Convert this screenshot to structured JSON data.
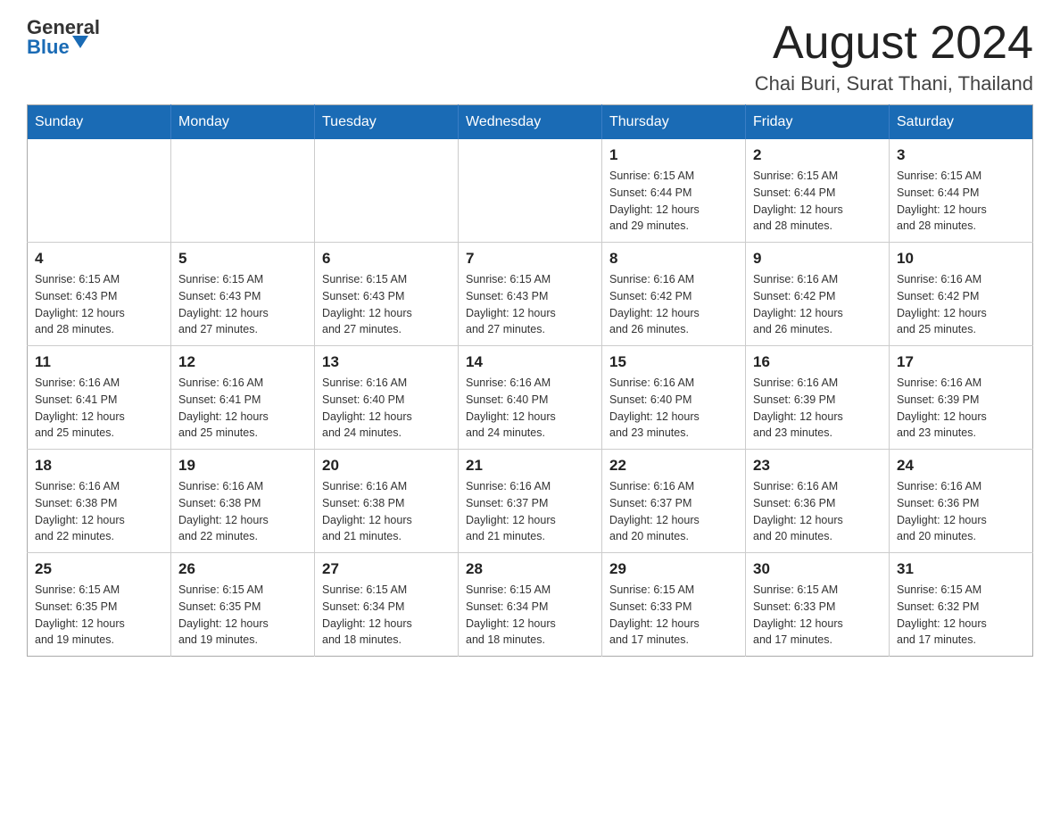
{
  "header": {
    "logo_general": "General",
    "logo_blue": "Blue",
    "month": "August 2024",
    "location": "Chai Buri, Surat Thani, Thailand"
  },
  "weekdays": [
    "Sunday",
    "Monday",
    "Tuesday",
    "Wednesday",
    "Thursday",
    "Friday",
    "Saturday"
  ],
  "weeks": [
    [
      {
        "day": "",
        "info": ""
      },
      {
        "day": "",
        "info": ""
      },
      {
        "day": "",
        "info": ""
      },
      {
        "day": "",
        "info": ""
      },
      {
        "day": "1",
        "info": "Sunrise: 6:15 AM\nSunset: 6:44 PM\nDaylight: 12 hours\nand 29 minutes."
      },
      {
        "day": "2",
        "info": "Sunrise: 6:15 AM\nSunset: 6:44 PM\nDaylight: 12 hours\nand 28 minutes."
      },
      {
        "day": "3",
        "info": "Sunrise: 6:15 AM\nSunset: 6:44 PM\nDaylight: 12 hours\nand 28 minutes."
      }
    ],
    [
      {
        "day": "4",
        "info": "Sunrise: 6:15 AM\nSunset: 6:43 PM\nDaylight: 12 hours\nand 28 minutes."
      },
      {
        "day": "5",
        "info": "Sunrise: 6:15 AM\nSunset: 6:43 PM\nDaylight: 12 hours\nand 27 minutes."
      },
      {
        "day": "6",
        "info": "Sunrise: 6:15 AM\nSunset: 6:43 PM\nDaylight: 12 hours\nand 27 minutes."
      },
      {
        "day": "7",
        "info": "Sunrise: 6:15 AM\nSunset: 6:43 PM\nDaylight: 12 hours\nand 27 minutes."
      },
      {
        "day": "8",
        "info": "Sunrise: 6:16 AM\nSunset: 6:42 PM\nDaylight: 12 hours\nand 26 minutes."
      },
      {
        "day": "9",
        "info": "Sunrise: 6:16 AM\nSunset: 6:42 PM\nDaylight: 12 hours\nand 26 minutes."
      },
      {
        "day": "10",
        "info": "Sunrise: 6:16 AM\nSunset: 6:42 PM\nDaylight: 12 hours\nand 25 minutes."
      }
    ],
    [
      {
        "day": "11",
        "info": "Sunrise: 6:16 AM\nSunset: 6:41 PM\nDaylight: 12 hours\nand 25 minutes."
      },
      {
        "day": "12",
        "info": "Sunrise: 6:16 AM\nSunset: 6:41 PM\nDaylight: 12 hours\nand 25 minutes."
      },
      {
        "day": "13",
        "info": "Sunrise: 6:16 AM\nSunset: 6:40 PM\nDaylight: 12 hours\nand 24 minutes."
      },
      {
        "day": "14",
        "info": "Sunrise: 6:16 AM\nSunset: 6:40 PM\nDaylight: 12 hours\nand 24 minutes."
      },
      {
        "day": "15",
        "info": "Sunrise: 6:16 AM\nSunset: 6:40 PM\nDaylight: 12 hours\nand 23 minutes."
      },
      {
        "day": "16",
        "info": "Sunrise: 6:16 AM\nSunset: 6:39 PM\nDaylight: 12 hours\nand 23 minutes."
      },
      {
        "day": "17",
        "info": "Sunrise: 6:16 AM\nSunset: 6:39 PM\nDaylight: 12 hours\nand 23 minutes."
      }
    ],
    [
      {
        "day": "18",
        "info": "Sunrise: 6:16 AM\nSunset: 6:38 PM\nDaylight: 12 hours\nand 22 minutes."
      },
      {
        "day": "19",
        "info": "Sunrise: 6:16 AM\nSunset: 6:38 PM\nDaylight: 12 hours\nand 22 minutes."
      },
      {
        "day": "20",
        "info": "Sunrise: 6:16 AM\nSunset: 6:38 PM\nDaylight: 12 hours\nand 21 minutes."
      },
      {
        "day": "21",
        "info": "Sunrise: 6:16 AM\nSunset: 6:37 PM\nDaylight: 12 hours\nand 21 minutes."
      },
      {
        "day": "22",
        "info": "Sunrise: 6:16 AM\nSunset: 6:37 PM\nDaylight: 12 hours\nand 20 minutes."
      },
      {
        "day": "23",
        "info": "Sunrise: 6:16 AM\nSunset: 6:36 PM\nDaylight: 12 hours\nand 20 minutes."
      },
      {
        "day": "24",
        "info": "Sunrise: 6:16 AM\nSunset: 6:36 PM\nDaylight: 12 hours\nand 20 minutes."
      }
    ],
    [
      {
        "day": "25",
        "info": "Sunrise: 6:15 AM\nSunset: 6:35 PM\nDaylight: 12 hours\nand 19 minutes."
      },
      {
        "day": "26",
        "info": "Sunrise: 6:15 AM\nSunset: 6:35 PM\nDaylight: 12 hours\nand 19 minutes."
      },
      {
        "day": "27",
        "info": "Sunrise: 6:15 AM\nSunset: 6:34 PM\nDaylight: 12 hours\nand 18 minutes."
      },
      {
        "day": "28",
        "info": "Sunrise: 6:15 AM\nSunset: 6:34 PM\nDaylight: 12 hours\nand 18 minutes."
      },
      {
        "day": "29",
        "info": "Sunrise: 6:15 AM\nSunset: 6:33 PM\nDaylight: 12 hours\nand 17 minutes."
      },
      {
        "day": "30",
        "info": "Sunrise: 6:15 AM\nSunset: 6:33 PM\nDaylight: 12 hours\nand 17 minutes."
      },
      {
        "day": "31",
        "info": "Sunrise: 6:15 AM\nSunset: 6:32 PM\nDaylight: 12 hours\nand 17 minutes."
      }
    ]
  ]
}
